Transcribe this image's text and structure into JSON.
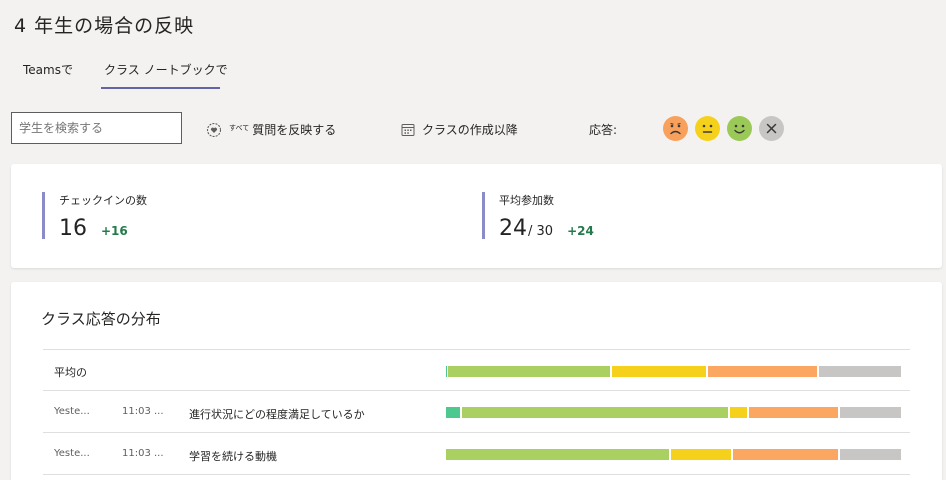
{
  "page": {
    "title": "4 年生の場合の反映"
  },
  "tabs": [
    {
      "label": "Teamsで"
    },
    {
      "label": "クラス ノートブックで"
    }
  ],
  "toolbar": {
    "search_placeholder": "学生を検索する",
    "filter_sup": "すべて",
    "filter_label": "質問を反映する",
    "date_label": "クラスの作成以降",
    "responses_label": "応答:"
  },
  "emojis": [
    {
      "name": "sad",
      "color": "#f7a15d"
    },
    {
      "name": "neutral",
      "color": "#f6d11c"
    },
    {
      "name": "happy",
      "color": "#9bc957"
    },
    {
      "name": "none",
      "color": "#c8c6c4"
    }
  ],
  "stats": {
    "checkins": {
      "label": "チェックインの数",
      "value": "16",
      "delta": "+16"
    },
    "participation": {
      "label": "平均参加数",
      "value": "24",
      "total": "/ 30",
      "delta": "+24"
    }
  },
  "distribution": {
    "title": "クラス応答の分布",
    "rows": [
      {
        "date": "",
        "time": "",
        "question": "平均の",
        "segments": [
          {
            "key": "very-good",
            "fraction": 0.005,
            "color": "#4dc98f"
          },
          {
            "key": "good",
            "fraction": 0.36,
            "color": "#a9d060"
          },
          {
            "key": "ok",
            "fraction": 0.21,
            "color": "#f6d11c"
          },
          {
            "key": "bad",
            "fraction": 0.245,
            "color": "#fba661"
          },
          {
            "key": "none",
            "fraction": 0.18,
            "color": "#c8c6c4"
          }
        ]
      },
      {
        "date": "Yeste...",
        "time": "11:03 ...",
        "question": "進行状況にどの程度満足しているか",
        "segments": [
          {
            "key": "very-good",
            "fraction": 0.035,
            "color": "#4dc98f"
          },
          {
            "key": "good",
            "fraction": 0.59,
            "color": "#a9d060"
          },
          {
            "key": "ok",
            "fraction": 0.04,
            "color": "#f6d11c"
          },
          {
            "key": "bad",
            "fraction": 0.2,
            "color": "#fba661"
          },
          {
            "key": "none",
            "fraction": 0.135,
            "color": "#c8c6c4"
          }
        ]
      },
      {
        "date": "Yeste...",
        "time": "11:03 ...",
        "question": "学習を続ける動機",
        "segments": [
          {
            "key": "good",
            "fraction": 0.495,
            "color": "#a9d060"
          },
          {
            "key": "ok",
            "fraction": 0.135,
            "color": "#f6d11c"
          },
          {
            "key": "bad",
            "fraction": 0.235,
            "color": "#fba661"
          },
          {
            "key": "none",
            "fraction": 0.135,
            "color": "#c8c6c4"
          }
        ]
      }
    ]
  }
}
